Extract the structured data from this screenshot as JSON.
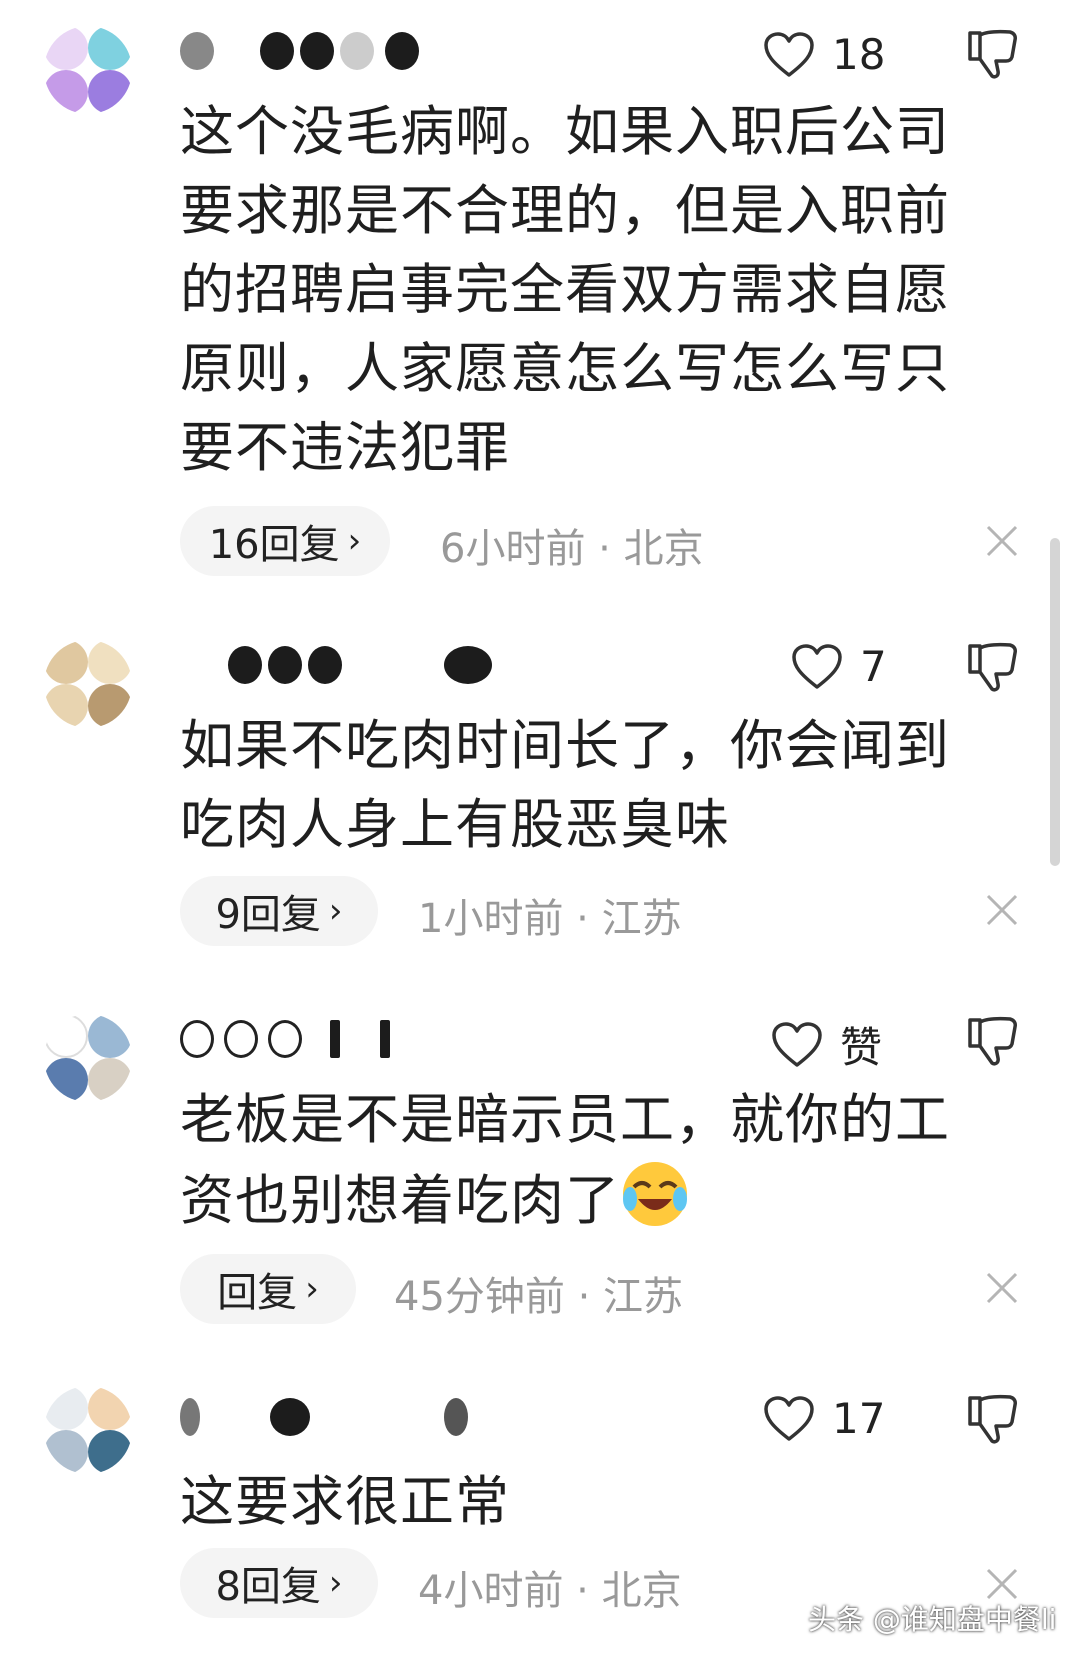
{
  "comments": [
    {
      "likes": "18",
      "text": "这个没毛病啊。如果入职后公司要求那是不合理的，但是入职前的招聘启事完全看双方需求自愿原则，人家愿意怎么写怎么写只要不违法犯罪",
      "replies": "16回复",
      "meta": "6小时前 · 北京"
    },
    {
      "likes": "7",
      "text": "如果不吃肉时间长了，你会闻到吃肉人身上有股恶臭味",
      "replies": "9回复",
      "meta": "1小时前 · 江苏"
    },
    {
      "likes": "赞",
      "text": "老板是不是暗示员工，就你的工资也别想着吃肉了",
      "replies": "回复",
      "meta": "45分钟前 · 江苏"
    },
    {
      "likes": "17",
      "text": "这要求很正常",
      "replies": "8回复",
      "meta": "4小时前 · 北京"
    }
  ],
  "watermark": "头条 @谁知盘中餐li",
  "colors": {
    "meta_gray": "#999999",
    "pill_bg": "#f4f4f4",
    "text": "#1f1f1f"
  },
  "icons": [
    "heart-icon",
    "dislike-icon",
    "chevron-right-icon",
    "close-icon",
    "laugh-cry-emoji-icon"
  ]
}
